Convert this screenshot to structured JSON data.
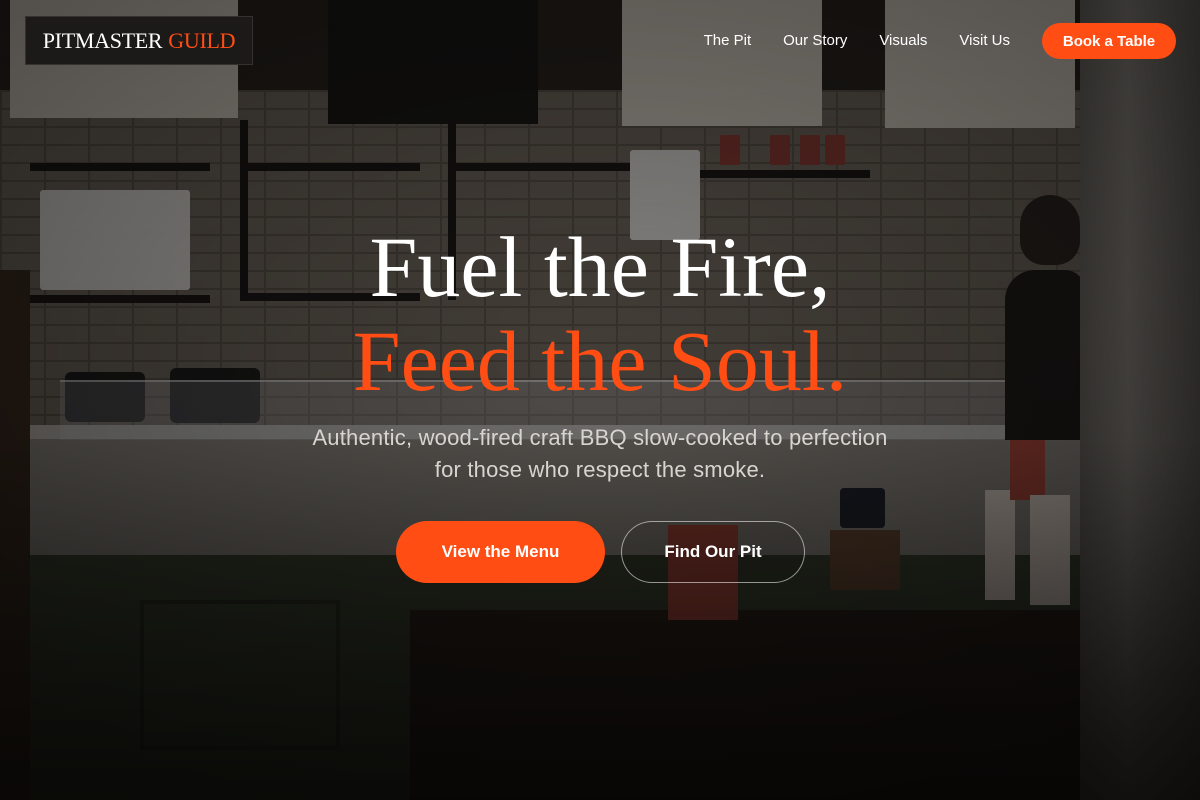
{
  "brand": {
    "name_main": "PITMASTER",
    "name_accent": "GUILD"
  },
  "nav": {
    "items": [
      {
        "label": "The Pit"
      },
      {
        "label": "Our Story"
      },
      {
        "label": "Visuals"
      },
      {
        "label": "Visit Us"
      }
    ],
    "cta_label": "Book a Table"
  },
  "hero": {
    "title_line1": "Fuel the Fire,",
    "title_line2": "Feed the Soul.",
    "subtitle_line1": "Authentic, wood-fired craft BBQ slow-cooked to perfection",
    "subtitle_line2": "for those who respect the smoke.",
    "primary_button": "View the Menu",
    "secondary_button": "Find Our Pit"
  },
  "colors": {
    "accent": "#ff4d13",
    "text": "#ffffff",
    "logo_bg": "#1b1a19"
  }
}
